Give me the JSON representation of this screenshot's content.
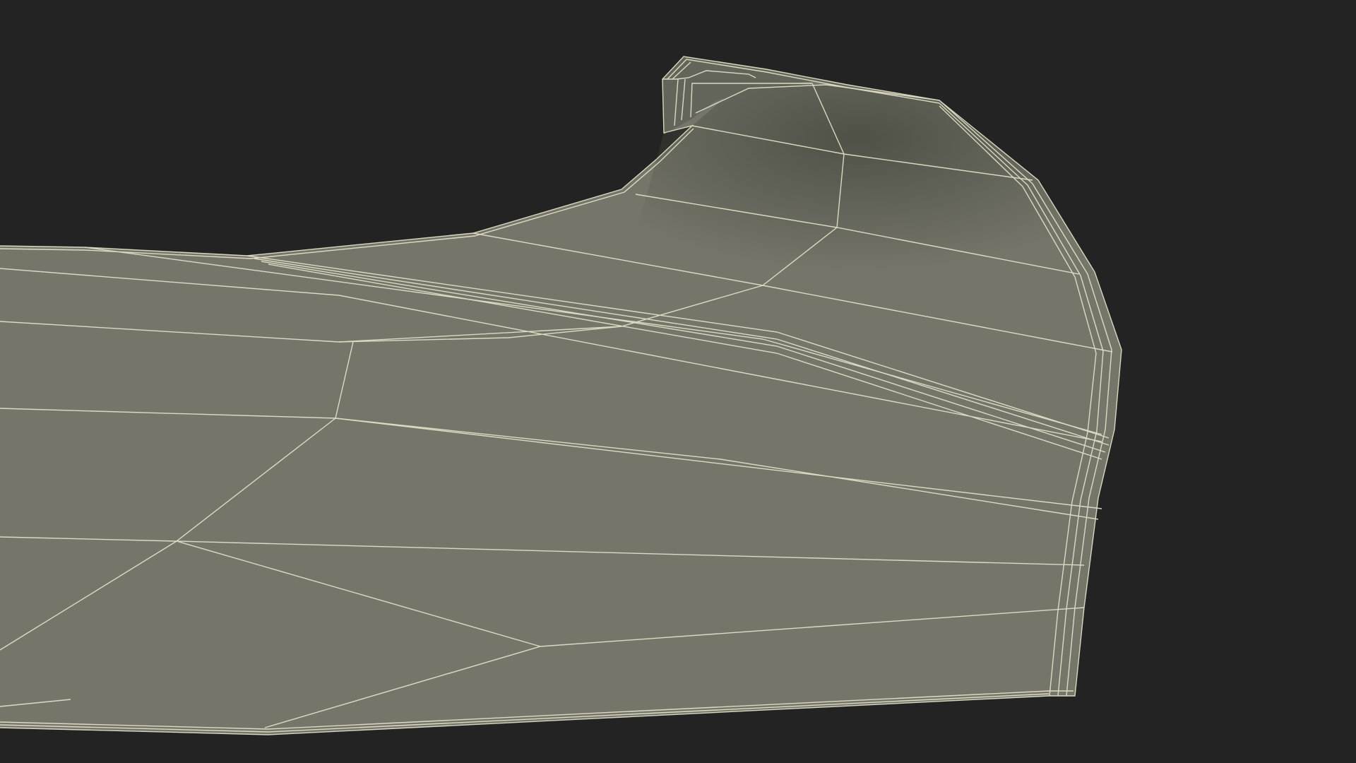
{
  "scene": {
    "subject": "wireframe-render",
    "background_color": "#232323",
    "surface_color": "#75756a",
    "surface_shadow_color": "#4a4b40",
    "wire_color": "#e8e6cc",
    "edge_color": "#d9d8c0"
  }
}
